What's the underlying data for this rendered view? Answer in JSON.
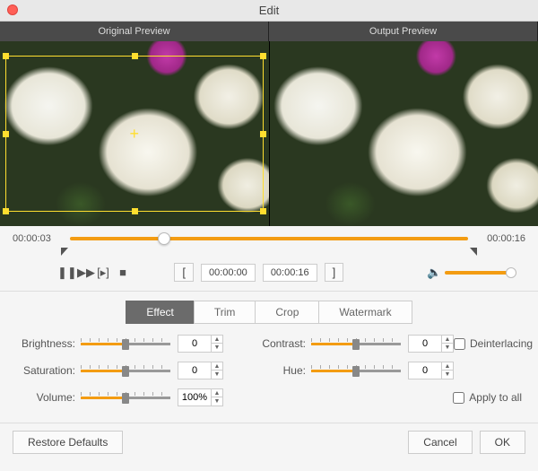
{
  "window": {
    "title": "Edit"
  },
  "preview": {
    "original_label": "Original Preview",
    "output_label": "Output Preview"
  },
  "timeline": {
    "current": "00:00:03",
    "duration": "00:00:16",
    "position_pct": 22
  },
  "playback": {
    "pause_icon": "❚❚",
    "ff_icon": "▶▶",
    "step_icon": "[▸]",
    "stop_icon": "■",
    "trim_in": "00:00:00",
    "trim_out": "00:00:16",
    "bracket_open": "[",
    "bracket_close": "]",
    "vol_icon": "🔈"
  },
  "tabs": {
    "effect": "Effect",
    "trim": "Trim",
    "crop": "Crop",
    "watermark": "Watermark"
  },
  "effects": {
    "brightness": {
      "label": "Brightness:",
      "value": "0"
    },
    "contrast": {
      "label": "Contrast:",
      "value": "0"
    },
    "saturation": {
      "label": "Saturation:",
      "value": "0"
    },
    "hue": {
      "label": "Hue:",
      "value": "0"
    },
    "volume": {
      "label": "Volume:",
      "value": "100%"
    },
    "deinterlacing": "Deinterlacing",
    "apply_all": "Apply to all"
  },
  "footer": {
    "restore": "Restore Defaults",
    "cancel": "Cancel",
    "ok": "OK"
  }
}
